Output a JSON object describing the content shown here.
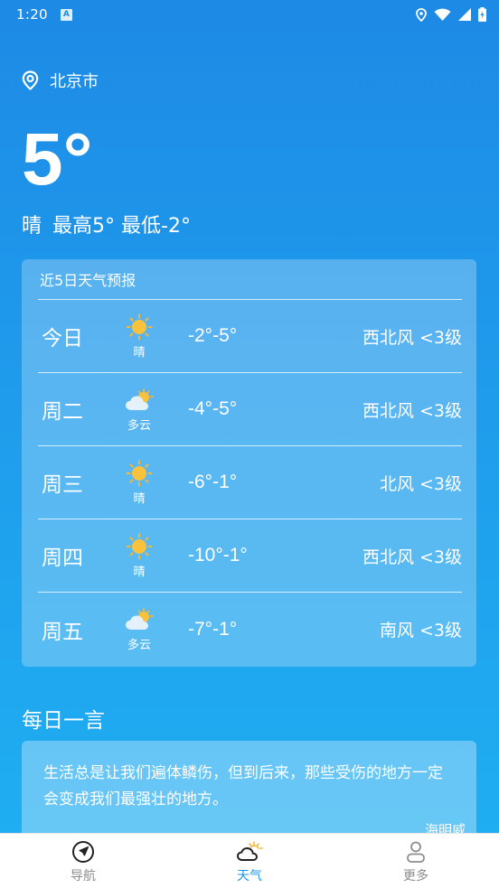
{
  "status_bar": {
    "time": "1:20",
    "notification_icon": "text-a-icon",
    "icons": [
      "location-icon",
      "wifi-icon",
      "signal-icon",
      "battery-icon"
    ]
  },
  "location": {
    "icon": "location-pin-icon",
    "city": "北京市"
  },
  "current": {
    "temperature": "5°",
    "condition": "晴",
    "high_low": "最高5° 最低-2°"
  },
  "forecast": {
    "title": "近5日天气预报",
    "days": [
      {
        "day": "今日",
        "icon": "sun-icon",
        "condition": "晴",
        "range": "-2°-5°",
        "wind": "西北风 <3级"
      },
      {
        "day": "周二",
        "icon": "cloud-sun-icon",
        "condition": "多云",
        "range": "-4°-5°",
        "wind": "西北风 <3级"
      },
      {
        "day": "周三",
        "icon": "sun-icon",
        "condition": "晴",
        "range": "-6°-1°",
        "wind": "北风 <3级"
      },
      {
        "day": "周四",
        "icon": "sun-icon",
        "condition": "晴",
        "range": "-10°-1°",
        "wind": "西北风 <3级"
      },
      {
        "day": "周五",
        "icon": "cloud-sun-icon",
        "condition": "多云",
        "range": "-7°-1°",
        "wind": "南风 <3级"
      }
    ]
  },
  "quote": {
    "heading": "每日一言",
    "text": "生活总是让我们遍体鳞伤，但到后来，那些受伤的地方一定会变成我们最强壮的地方。",
    "author": "海明威"
  },
  "bottom_nav": {
    "items": [
      {
        "label": "导航",
        "icon": "navigation-arrow-icon",
        "active": false
      },
      {
        "label": "天气",
        "icon": "weather-cloud-sun-icon",
        "active": true
      },
      {
        "label": "更多",
        "icon": "person-icon",
        "active": false
      }
    ]
  },
  "colors": {
    "background_top": "#1d8ae5",
    "background_bottom": "#1fb0f2",
    "accent": "#1e96ea",
    "nav_inactive": "#8c8c8c",
    "sun": "#f7b733"
  }
}
